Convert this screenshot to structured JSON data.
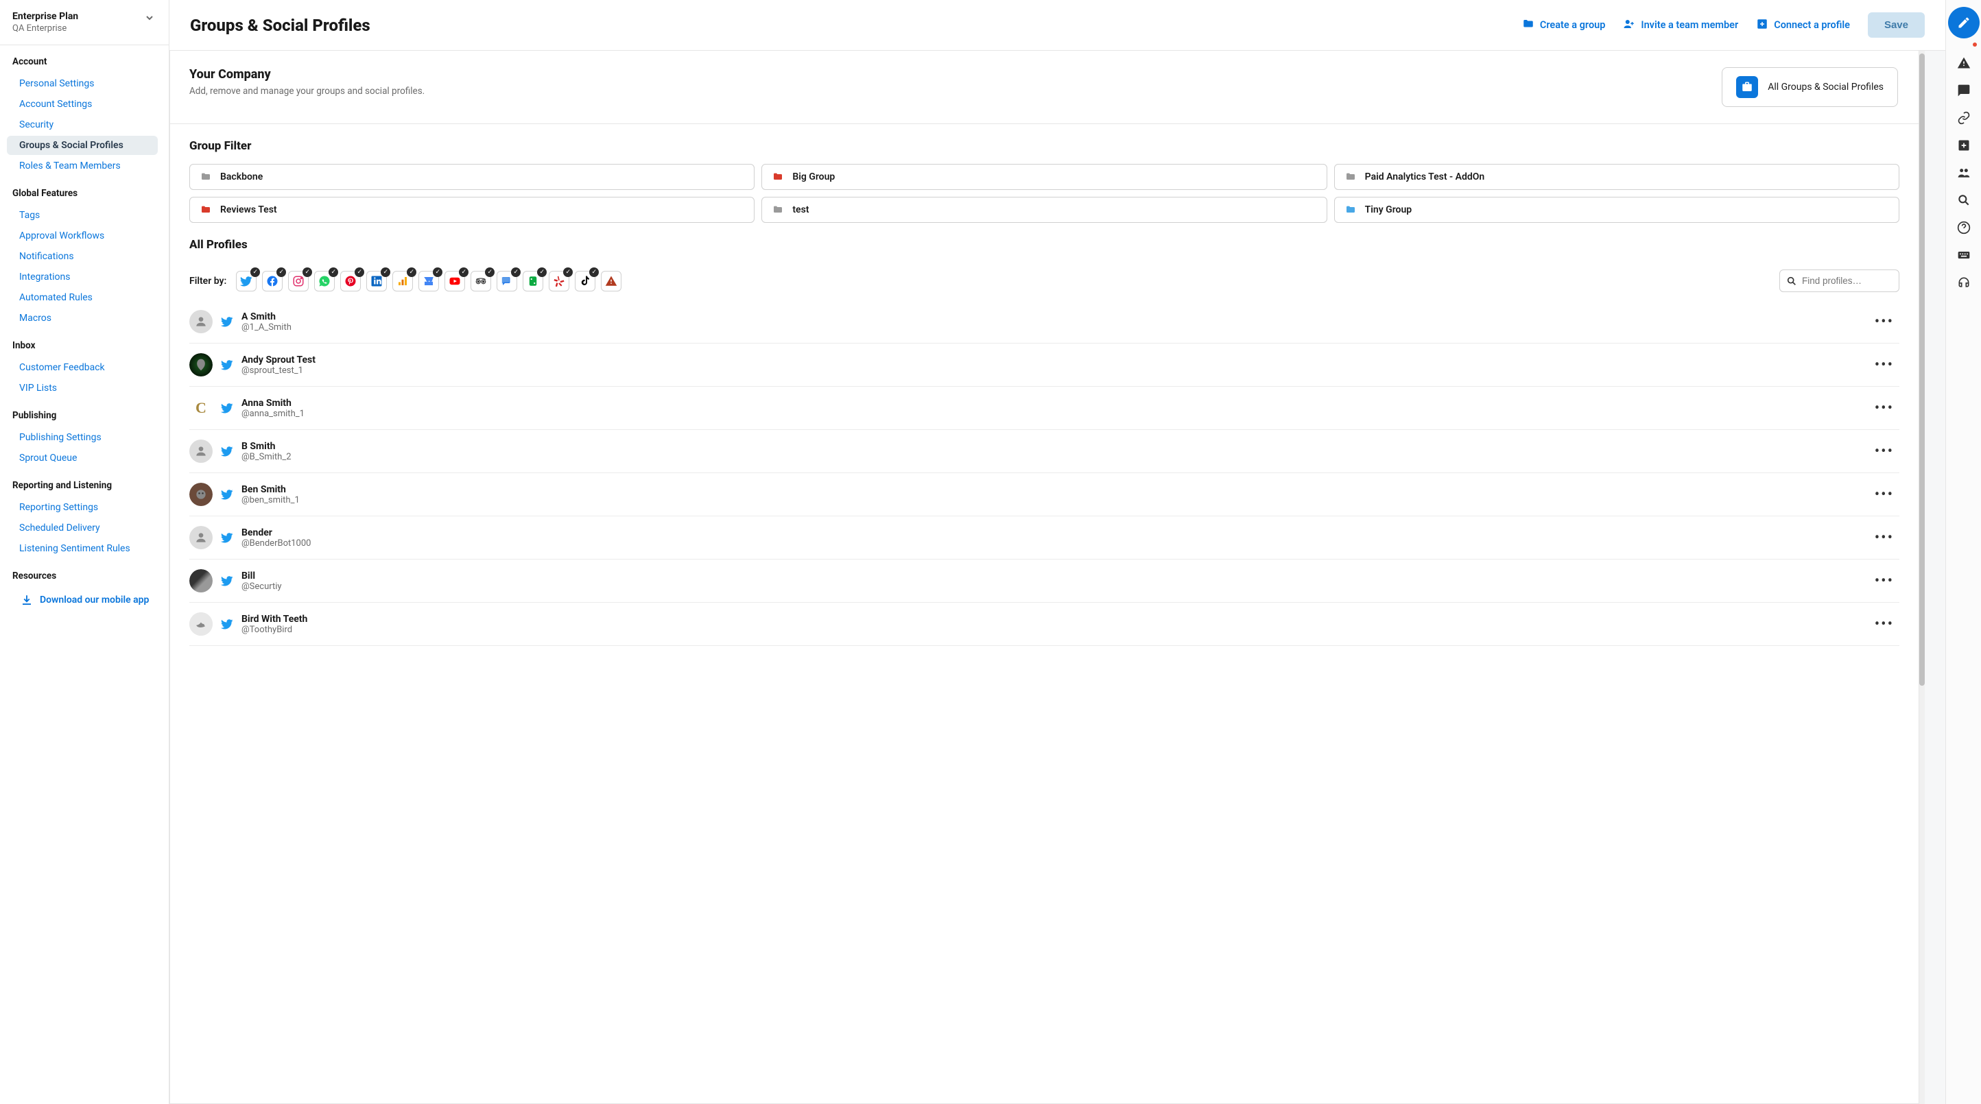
{
  "org": {
    "plan": "Enterprise Plan",
    "name": "QA Enterprise"
  },
  "sidebar": {
    "sections": [
      {
        "label": "Account",
        "items": [
          {
            "label": "Personal Settings"
          },
          {
            "label": "Account Settings"
          },
          {
            "label": "Security"
          },
          {
            "label": "Groups & Social Profiles",
            "active": true
          },
          {
            "label": "Roles & Team Members"
          }
        ]
      },
      {
        "label": "Global Features",
        "items": [
          {
            "label": "Tags"
          },
          {
            "label": "Approval Workflows"
          },
          {
            "label": "Notifications"
          },
          {
            "label": "Integrations"
          },
          {
            "label": "Automated Rules"
          },
          {
            "label": "Macros"
          }
        ]
      },
      {
        "label": "Inbox",
        "items": [
          {
            "label": "Customer Feedback"
          },
          {
            "label": "VIP Lists"
          }
        ]
      },
      {
        "label": "Publishing",
        "items": [
          {
            "label": "Publishing Settings"
          },
          {
            "label": "Sprout Queue"
          }
        ]
      },
      {
        "label": "Reporting and Listening",
        "items": [
          {
            "label": "Reporting Settings"
          },
          {
            "label": "Scheduled Delivery"
          },
          {
            "label": "Listening Sentiment Rules"
          }
        ]
      },
      {
        "label": "Resources",
        "items": []
      }
    ],
    "download": "Download our mobile app"
  },
  "header": {
    "title": "Groups & Social Profiles",
    "actions": {
      "create_group": "Create a group",
      "invite": "Invite a team member",
      "connect": "Connect a profile",
      "save": "Save"
    }
  },
  "company": {
    "heading": "Your Company",
    "sub": "Add, remove and manage your groups and social profiles.",
    "all_groups_label": "All Groups & Social Profiles"
  },
  "group_filter": {
    "title": "Group Filter",
    "groups": [
      {
        "name": "Backbone",
        "color": "#9a9a9a"
      },
      {
        "name": "Big Group",
        "color": "#d93b2b"
      },
      {
        "name": "Paid Analytics Test - AddOn",
        "color": "#9a9a9a"
      },
      {
        "name": "Reviews Test",
        "color": "#d93b2b"
      },
      {
        "name": "test",
        "color": "#9a9a9a"
      },
      {
        "name": "Tiny Group",
        "color": "#48a7e6"
      }
    ]
  },
  "all_profiles": {
    "title": "All Profiles",
    "filter_label": "Filter by:",
    "search_placeholder": "Find profiles…",
    "platforms": [
      {
        "name": "twitter",
        "color": "#1d9bf0"
      },
      {
        "name": "facebook",
        "color": "#1877f2"
      },
      {
        "name": "instagram",
        "color": "#e1306c"
      },
      {
        "name": "whatsapp",
        "color": "#25d366"
      },
      {
        "name": "pinterest",
        "color": "#e60023"
      },
      {
        "name": "linkedin",
        "color": "#0a66c2"
      },
      {
        "name": "google-analytics",
        "color": "#f9ab00"
      },
      {
        "name": "google-business",
        "color": "#4285f4"
      },
      {
        "name": "youtube",
        "color": "#ff0000"
      },
      {
        "name": "tripadvisor",
        "color": "#34e0a1"
      },
      {
        "name": "reviews",
        "color": "#2b7de9"
      },
      {
        "name": "glassdoor",
        "color": "#0caa41"
      },
      {
        "name": "yelp",
        "color": "#d32323"
      },
      {
        "name": "tiktok",
        "color": "#000000"
      },
      {
        "name": "warning",
        "color": "#b13a1f",
        "no_check": true
      }
    ],
    "profiles": [
      {
        "name": "A Smith",
        "handle": "@1_A_Smith",
        "avatar": "placeholder"
      },
      {
        "name": "Andy Sprout Test",
        "handle": "@sprout_test_1",
        "avatar": "green-logo"
      },
      {
        "name": "Anna Smith",
        "handle": "@anna_smith_1",
        "avatar": "letter-c"
      },
      {
        "name": "B Smith",
        "handle": "@B_Smith_2",
        "avatar": "placeholder"
      },
      {
        "name": "Ben Smith",
        "handle": "@ben_smith_1",
        "avatar": "cartoon-head"
      },
      {
        "name": "Bender",
        "handle": "@BenderBot1000",
        "avatar": "placeholder"
      },
      {
        "name": "Bill",
        "handle": "@Securtiy",
        "avatar": "bw-photo"
      },
      {
        "name": "Bird With Teeth",
        "handle": "@ToothyBird",
        "avatar": "gray-bird"
      }
    ]
  },
  "right_rail": {
    "icons": [
      "compose",
      "alert",
      "chat",
      "link",
      "add",
      "group",
      "search",
      "help",
      "keyboard",
      "headset"
    ]
  }
}
